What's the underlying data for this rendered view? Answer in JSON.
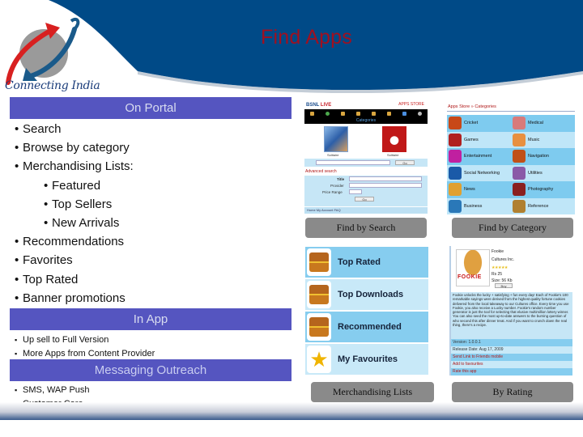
{
  "header": {
    "title": "Find Apps",
    "colors": {
      "band": "#004a87",
      "title": "#a01020",
      "section_bar": "#5555c0"
    }
  },
  "logo": {
    "tagline": "Connecting India"
  },
  "on_portal": {
    "heading": "On Portal",
    "items": [
      {
        "label": "Search",
        "level": 1
      },
      {
        "label": "Browse by category",
        "level": 1
      },
      {
        "label": "Merchandising Lists:",
        "level": 1
      },
      {
        "label": "Featured",
        "level": 2
      },
      {
        "label": "Top Sellers",
        "level": 2
      },
      {
        "label": "New Arrivals",
        "level": 2
      },
      {
        "label": "Recommendations",
        "level": 1
      },
      {
        "label": "Favorites",
        "level": 1
      },
      {
        "label": "Top Rated",
        "level": 1
      },
      {
        "label": "Banner promotions",
        "level": 1
      }
    ]
  },
  "in_app": {
    "heading": "In App",
    "items": [
      "Up sell to Full Version",
      "More Apps from Content Provider"
    ]
  },
  "messaging": {
    "heading": "Messaging Outreach",
    "items": [
      "SMS, WAP Push",
      "Customer Care"
    ]
  },
  "screenshots": {
    "search": {
      "caption": "Find by Search",
      "brand": "BSNL",
      "brand_live": "LIVE",
      "store": "APPS STORE",
      "categories_label": "Categories",
      "thumb1_label": "Solitaire",
      "thumb2_label": "Solitaire",
      "search_button": "Go",
      "advanced_label": "Advanced search",
      "form_labels": [
        "Title",
        "Provider",
        "Price Range"
      ],
      "form_button": "Go",
      "footer": "Home   My Account   FAQ"
    },
    "category": {
      "caption": "Find by Category",
      "breadcrumb": "Apps Store » Categories",
      "items": [
        {
          "label": "Cricket",
          "icon": "cricket-icon",
          "color": "#c84818"
        },
        {
          "label": "Medical",
          "icon": "medical-icon",
          "color": "#d87a7a"
        },
        {
          "label": "Games",
          "icon": "games-icon",
          "color": "#b02020"
        },
        {
          "label": "Music",
          "icon": "music-icon",
          "color": "#e89040"
        },
        {
          "label": "Entertainment",
          "icon": "entertainment-icon",
          "color": "#c020a0"
        },
        {
          "label": "Navigation",
          "icon": "navigation-icon",
          "color": "#c05018"
        },
        {
          "label": "Social Networking",
          "icon": "social-networking-icon",
          "color": "#1a5aa8"
        },
        {
          "label": "Utilities",
          "icon": "utilities-icon",
          "color": "#8a5aa8"
        },
        {
          "label": "News",
          "icon": "news-icon",
          "color": "#e0a030"
        },
        {
          "label": "Photography",
          "icon": "photography-icon",
          "color": "#8a2020"
        },
        {
          "label": "Business",
          "icon": "business-icon",
          "color": "#2a78b8"
        },
        {
          "label": "Reference",
          "icon": "reference-icon",
          "color": "#b08030"
        }
      ]
    },
    "merchandising": {
      "caption": "Merchandising Lists",
      "items": [
        {
          "label": "Top Rated",
          "icon": "treasure-chest-icon"
        },
        {
          "label": "Top Downloads",
          "icon": "treasure-chest-icon"
        },
        {
          "label": "Recommended",
          "icon": "treasure-chest-icon"
        },
        {
          "label": "My Favourites",
          "icon": "star-icon"
        }
      ]
    },
    "rating": {
      "caption": "By Rating",
      "app_name": "Fookie",
      "publisher": "Cultures Inc.",
      "stars": "★★★★★",
      "price": "Rs 25",
      "size": "Size: 56 Kb",
      "buy_button": "Buy",
      "logo_text": "FOOKIE",
      "description": "Fookie unlocks the lucky + satisfying + fun every day! Each of Fookie's 100 remarkable sayings were derived from the highest quality fortune cookies delivered from the local takeaway to our Cultures office. Every time you use Fookie, you also receive a Lucky number. Fookie's random number generator is just the tool for selecting that elusive multimillion lottery winner. You can also seed the most up-to-date answers to the burning question of who second this after dinner treat. And if you want to crunch down the real thing, there's a recipe.",
      "version": "Version: 1.0.0.1",
      "release_date": "Release Date: Aug 17, 2009",
      "send_link": "Send Link to Friends mobile",
      "add_fav": "Add to favourites",
      "rate": "Rate this app"
    }
  }
}
